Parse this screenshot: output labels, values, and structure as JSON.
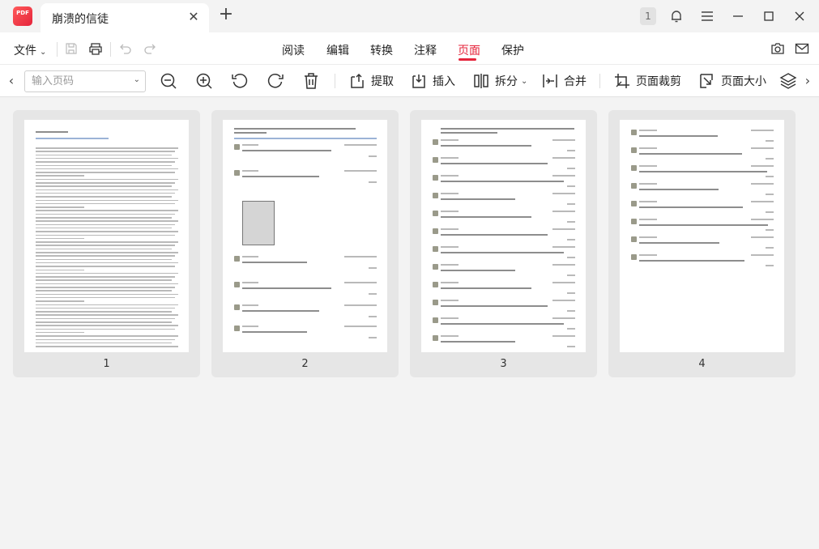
{
  "titlebar": {
    "app_logo_text": "PDF",
    "tab_title": "崩溃的信徒",
    "page_count_badge": "1",
    "icons": [
      "close-icon",
      "plus-icon",
      "bell-icon",
      "hamburger-menu-icon",
      "minimize-icon",
      "maximize-icon",
      "window-close-icon"
    ]
  },
  "menubar": {
    "file_label": "文件",
    "nav": [
      {
        "label": "阅读"
      },
      {
        "label": "编辑"
      },
      {
        "label": "转换"
      },
      {
        "label": "注释"
      },
      {
        "label": "页面",
        "active": true
      },
      {
        "label": "保护"
      }
    ]
  },
  "toolbar": {
    "page_input_placeholder": "输入页码",
    "extract_label": "提取",
    "insert_label": "插入",
    "split_label": "拆分",
    "merge_label": "合并",
    "crop_label": "页面裁剪",
    "page_size_label": "页面大小"
  },
  "pages": [
    {
      "number": "1"
    },
    {
      "number": "2"
    },
    {
      "number": "3"
    },
    {
      "number": "4"
    }
  ],
  "colors": {
    "accent": "#e5243b",
    "background": "#f3f3f3",
    "card": "#e6e6e6"
  }
}
